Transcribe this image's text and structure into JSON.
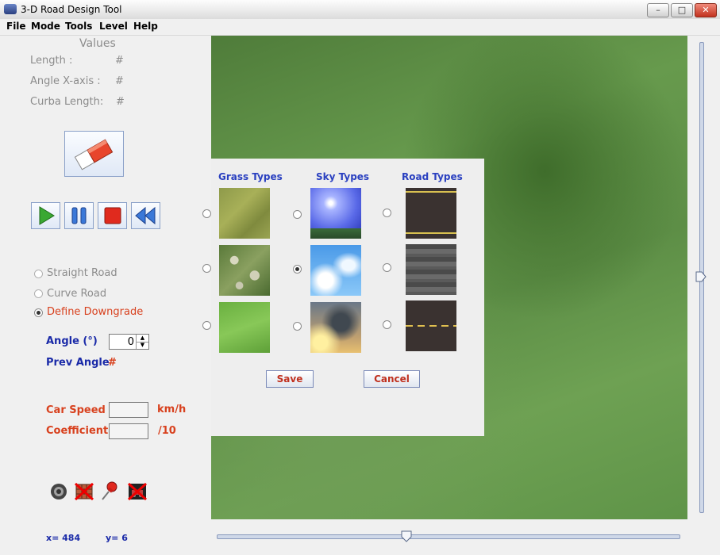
{
  "window": {
    "title": "3-D Road Design Tool",
    "minimize_glyph": "–",
    "maximize_glyph": "□",
    "close_glyph": "✕"
  },
  "menu": {
    "file": "File",
    "mode": "Mode",
    "tools": "Tools",
    "level": "Level",
    "help": "Help"
  },
  "values": {
    "heading": "Values",
    "length_label": "Length :",
    "length_value": "#",
    "angle_label": "Angle X-axis :",
    "angle_value": "#",
    "curba_label": "Curba Length:",
    "curba_value": "#"
  },
  "road_modes": {
    "straight": "Straight Road",
    "curve": "Curve Road",
    "downgrade": "Define Downgrade",
    "selected": "downgrade"
  },
  "angle": {
    "label": "Angle (°)",
    "value": "0",
    "prev_label": "Prev Angle",
    "prev_value": "#"
  },
  "car": {
    "speed_label": "Car Speed",
    "speed_value": "",
    "speed_unit": "km/h",
    "coef_label": "Coefficient",
    "coef_value": "",
    "coef_unit": "/10"
  },
  "status": {
    "x": "x= 484",
    "y": "y= 6"
  },
  "dialog": {
    "grass_heading": "Grass Types",
    "sky_heading": "Sky Types",
    "road_heading": "Road Types",
    "selected_sky": 1,
    "save": "Save",
    "cancel": "Cancel"
  },
  "sliders": {
    "horizontal_position": 0.41,
    "vertical_position": 0.5
  },
  "icons": [
    "play-icon",
    "pause-icon",
    "stop-icon",
    "rewind-icon",
    "eraser-icon",
    "speaker-icon",
    "delete-grid-icon",
    "pin-icon",
    "no-car-icon"
  ],
  "colors": {
    "accent_orange": "#d8411e",
    "accent_blue": "#1a2aa8",
    "dialog_heading": "#2a40c0"
  }
}
